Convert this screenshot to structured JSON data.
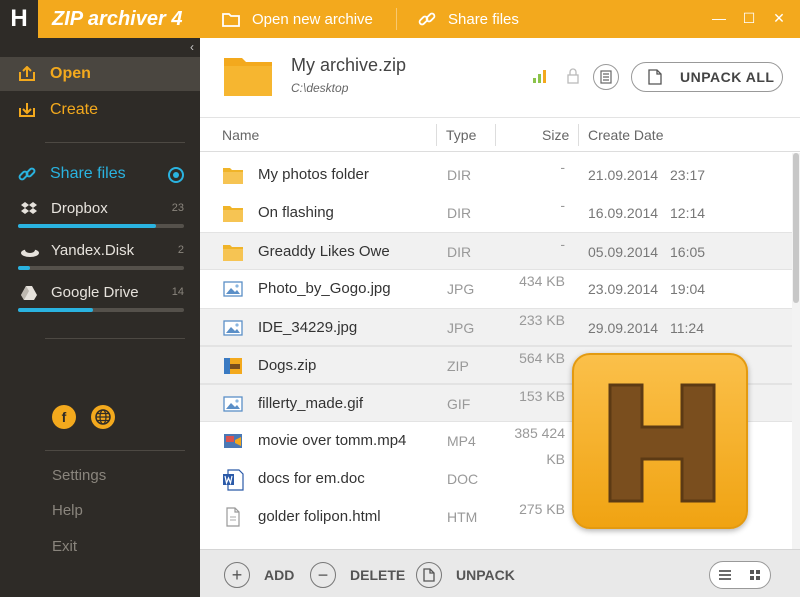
{
  "app": {
    "logo_letter": "H",
    "title": "ZIP archiver 4"
  },
  "sidebar": {
    "collapse_glyph": "‹",
    "open_label": "Open",
    "create_label": "Create",
    "share_label": "Share files",
    "clouds": [
      {
        "name": "Dropbox",
        "count": "23",
        "fill": 0.83
      },
      {
        "name": "Yandex.Disk",
        "count": "2",
        "fill": 0.07
      },
      {
        "name": "Google Drive",
        "count": "14",
        "fill": 0.45
      }
    ],
    "social": {
      "facebook": "f"
    },
    "settings_label": "Settings",
    "help_label": "Help",
    "exit_label": "Exit"
  },
  "topbar": {
    "open_new_label": "Open new archive",
    "share_label": "Share files",
    "minimize": "—",
    "maximize": "☐",
    "close": "✕"
  },
  "archive": {
    "name": "My archive.zip",
    "path": "C:\\desktop",
    "unpack_all_label": "UNPACK ALL"
  },
  "columns": {
    "name": "Name",
    "type": "Type",
    "size": "Size",
    "date": "Create Date"
  },
  "files": [
    {
      "name": "My photos folder",
      "type": "DIR",
      "size": "-",
      "date": "21.09.2014",
      "time": "23:17",
      "icon": "folder-icon"
    },
    {
      "name": "On flashing",
      "type": "DIR",
      "size": "-",
      "date": "16.09.2014",
      "time": "12:14",
      "icon": "folder-icon"
    },
    {
      "name": "Greaddy Likes Owe",
      "type": "DIR",
      "size": "-",
      "date": "05.09.2014",
      "time": "16:05",
      "icon": "folder-icon"
    },
    {
      "name": "Photo_by_Gogo.jpg",
      "type": "JPG",
      "size": "434 KB",
      "date": "23.09.2014",
      "time": "19:04",
      "icon": "image-icon"
    },
    {
      "name": "IDE_34229.jpg",
      "type": "JPG",
      "size": "233 KB",
      "date": "29.09.2014",
      "time": "11:24",
      "icon": "image-icon"
    },
    {
      "name": "Dogs.zip",
      "type": "ZIP",
      "size": "564 KB",
      "date": "",
      "time": "",
      "icon": "zip-icon"
    },
    {
      "name": "fillerty_made.gif",
      "type": "GIF",
      "size": "153 KB",
      "date": "",
      "time": "",
      "icon": "image-icon"
    },
    {
      "name": "movie over tomm.mp4",
      "type": "MP4",
      "size": "385 424\nKB",
      "date": "",
      "time": "",
      "icon": "video-icon"
    },
    {
      "name": "docs for em.doc",
      "type": "DOC",
      "size": "",
      "date": "",
      "time": "",
      "icon": "word-doc-icon"
    },
    {
      "name": "golder folipon.html",
      "type": "HTM",
      "size": "275 KB",
      "date": "",
      "time": "",
      "icon": "html-file-icon"
    }
  ],
  "bottombar": {
    "add_label": "ADD",
    "delete_label": "DELETE",
    "unpack_label": "UNPACK",
    "add_glyph": "+",
    "delete_glyph": "−"
  }
}
